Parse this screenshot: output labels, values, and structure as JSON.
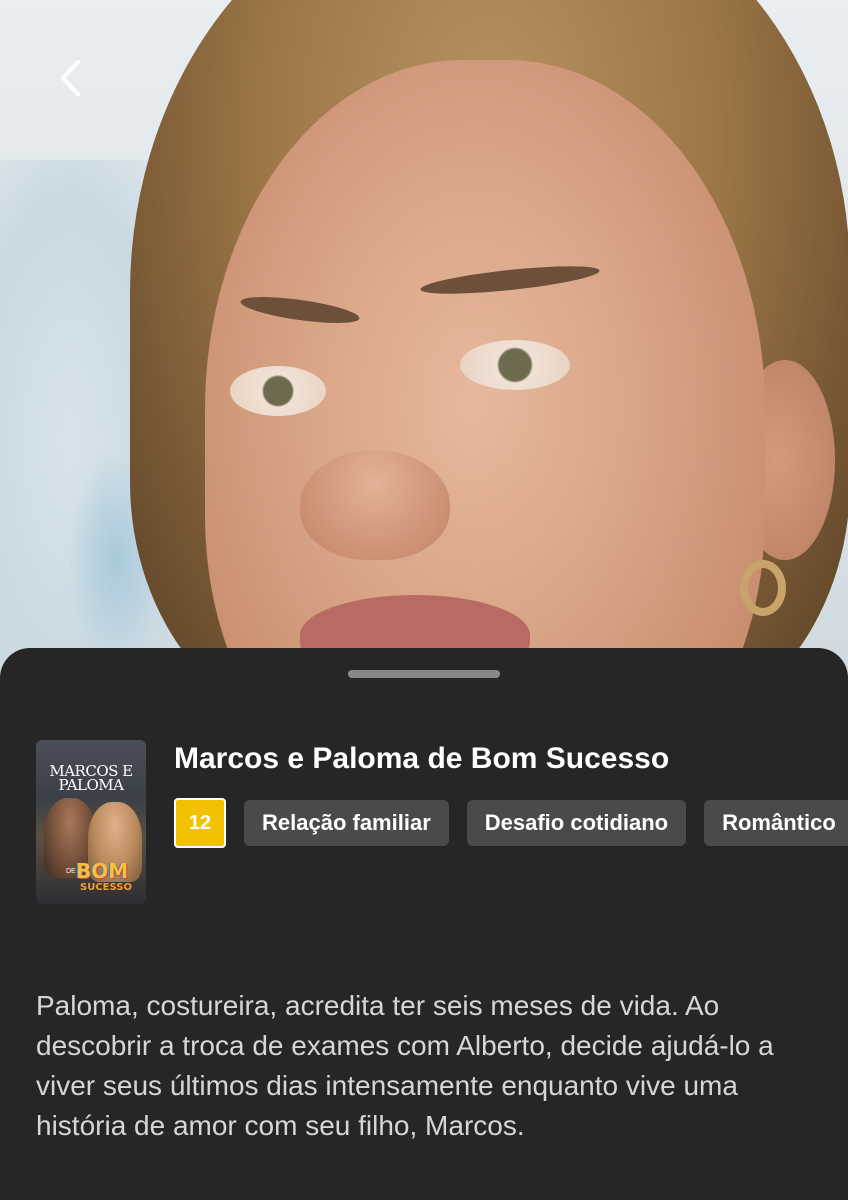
{
  "nav": {
    "back_icon": "chevron-left-icon"
  },
  "show": {
    "poster_title": "MARCOS E PALOMA",
    "poster_logo_prefix": "DE",
    "poster_logo": "BOM",
    "poster_logo_sub": "SUCESSO",
    "title": "Marcos e Paloma de Bom Sucesso",
    "age_rating": "12",
    "age_rating_color": "#f2c200",
    "tags": [
      {
        "label": "Relação familiar"
      },
      {
        "label": "Desafio cotidiano"
      },
      {
        "label": "Romântico"
      }
    ],
    "synopsis": "Paloma, costureira, acredita ter seis meses de vida. Ao descobrir a troca de exames com Alberto, decide ajudá-lo a viver seus últimos dias intensamente enquanto vive uma história de amor com seu filho, Marcos."
  },
  "colors": {
    "sheet_background": "#262626",
    "tag_background": "#4a4a4a",
    "grabber": "#8a8a8a"
  }
}
